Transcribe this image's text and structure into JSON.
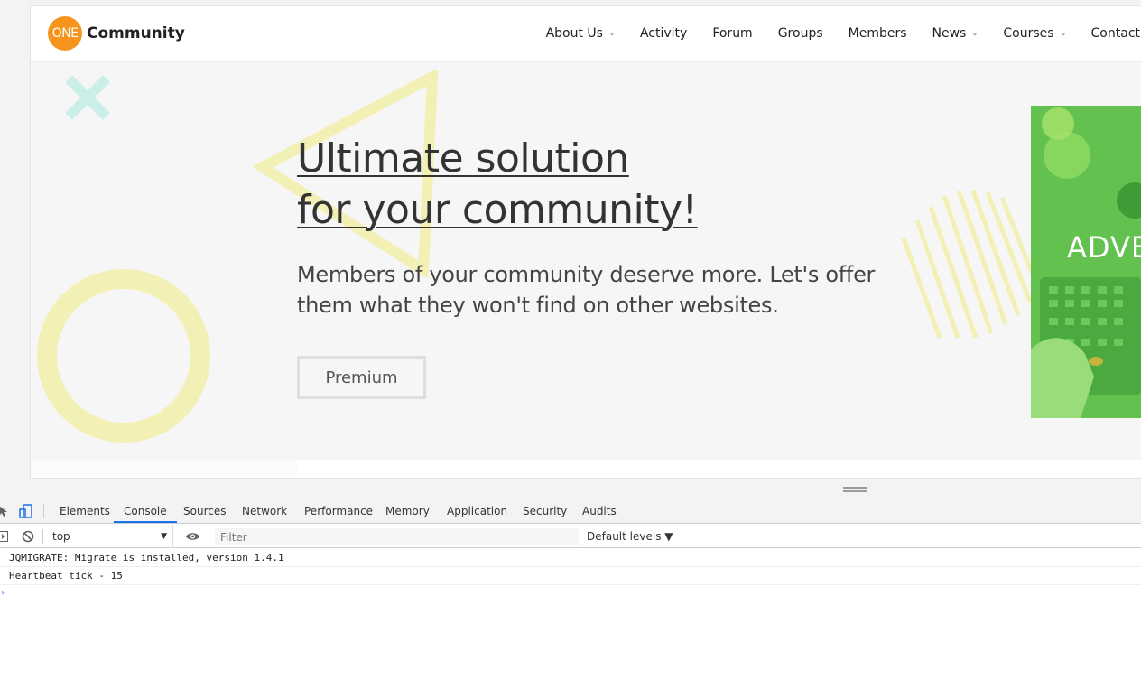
{
  "site": {
    "logo_badge": "ONE",
    "logo_text": "Community",
    "nav": [
      {
        "label": "About Us",
        "has_dropdown": true
      },
      {
        "label": "Activity",
        "has_dropdown": false
      },
      {
        "label": "Forum",
        "has_dropdown": false
      },
      {
        "label": "Groups",
        "has_dropdown": false
      },
      {
        "label": "Members",
        "has_dropdown": false
      },
      {
        "label": "News",
        "has_dropdown": true
      },
      {
        "label": "Courses",
        "has_dropdown": true
      },
      {
        "label": "Contact",
        "has_dropdown": false
      }
    ],
    "hero": {
      "title_line1": "Ultimate solution",
      "title_line2": "for your community!",
      "subtitle_line1": "Members of your community deserve more. Let's offer",
      "subtitle_line2": "them what they won't find on other websites.",
      "button_label": "Premium",
      "ad_text": "ADVE"
    }
  },
  "devtools": {
    "tabs": [
      "Elements",
      "Console",
      "Sources",
      "Network",
      "Performance",
      "Memory",
      "Application",
      "Security",
      "Audits"
    ],
    "active_tab": "Console",
    "context": "top",
    "filter_placeholder": "Filter",
    "levels_label": "Default levels ▼",
    "console_lines": [
      "JQMIGRATE: Migrate is installed, version 1.4.1",
      "Heartbeat tick - 15"
    ]
  },
  "colors": {
    "logo_orange": "#f7941d",
    "ad_green": "#63c24f",
    "deco_yellow": "#f3f0b6",
    "deco_mint": "#c9efe8",
    "devtools_active": "#1a73e8"
  }
}
